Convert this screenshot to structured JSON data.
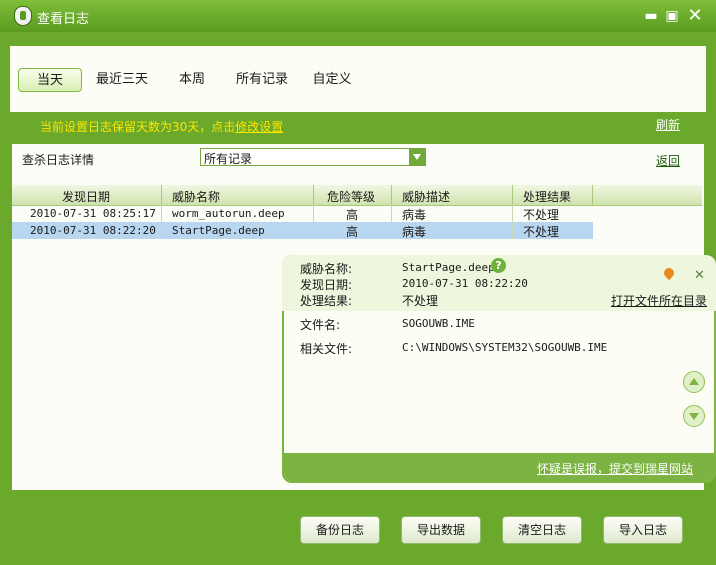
{
  "window": {
    "title": "查看日志"
  },
  "tabs": [
    {
      "label": "当天"
    },
    {
      "label": "最近三天"
    },
    {
      "label": "本周"
    },
    {
      "label": "所有记录"
    },
    {
      "label": "自定义"
    }
  ],
  "notice": {
    "text": "当前设置日志保留天数为30天，点击",
    "link": "修改设置"
  },
  "refresh_label": "刷新",
  "filter": {
    "label": "查杀日志详情",
    "selected": "所有记录",
    "back_label": "返回"
  },
  "table": {
    "headers": [
      "发现日期",
      "威胁名称",
      "危险等级",
      "威胁描述",
      "处理结果"
    ],
    "rows": [
      {
        "date": "2010-07-31 08:25:17",
        "name": "worm_autorun.deep",
        "level": "高",
        "desc": "病毒",
        "result": "不处理"
      },
      {
        "date": "2010-07-31 08:22:20",
        "name": "StartPage.deep",
        "level": "高",
        "desc": "病毒",
        "result": "不处理"
      }
    ]
  },
  "detail": {
    "threat_name_label": "威胁名称:",
    "threat_name": "StartPage.deep",
    "found_date_label": "发现日期:",
    "found_date": "2010-07-31 08:22:20",
    "result_label": "处理结果:",
    "result": "不处理",
    "open_folder": "打开文件所在目录",
    "file_name_label": "文件名:",
    "file_name": "SOGOUWB.IME",
    "related_file_label": "相关文件:",
    "related_file": "C:\\WINDOWS\\SYSTEM32\\SOGOUWB.IME",
    "report_link": "怀疑是误报，提交到瑞星网站",
    "help_glyph": "?"
  },
  "buttons": {
    "backup": "备份日志",
    "export": "导出数据",
    "clear": "清空日志",
    "import": "导入日志"
  },
  "icons": [
    "shield-icon",
    "minimize-icon",
    "restore-icon",
    "close-icon",
    "help-icon",
    "pin-icon",
    "scroll-up-icon",
    "scroll-down-icon"
  ]
}
